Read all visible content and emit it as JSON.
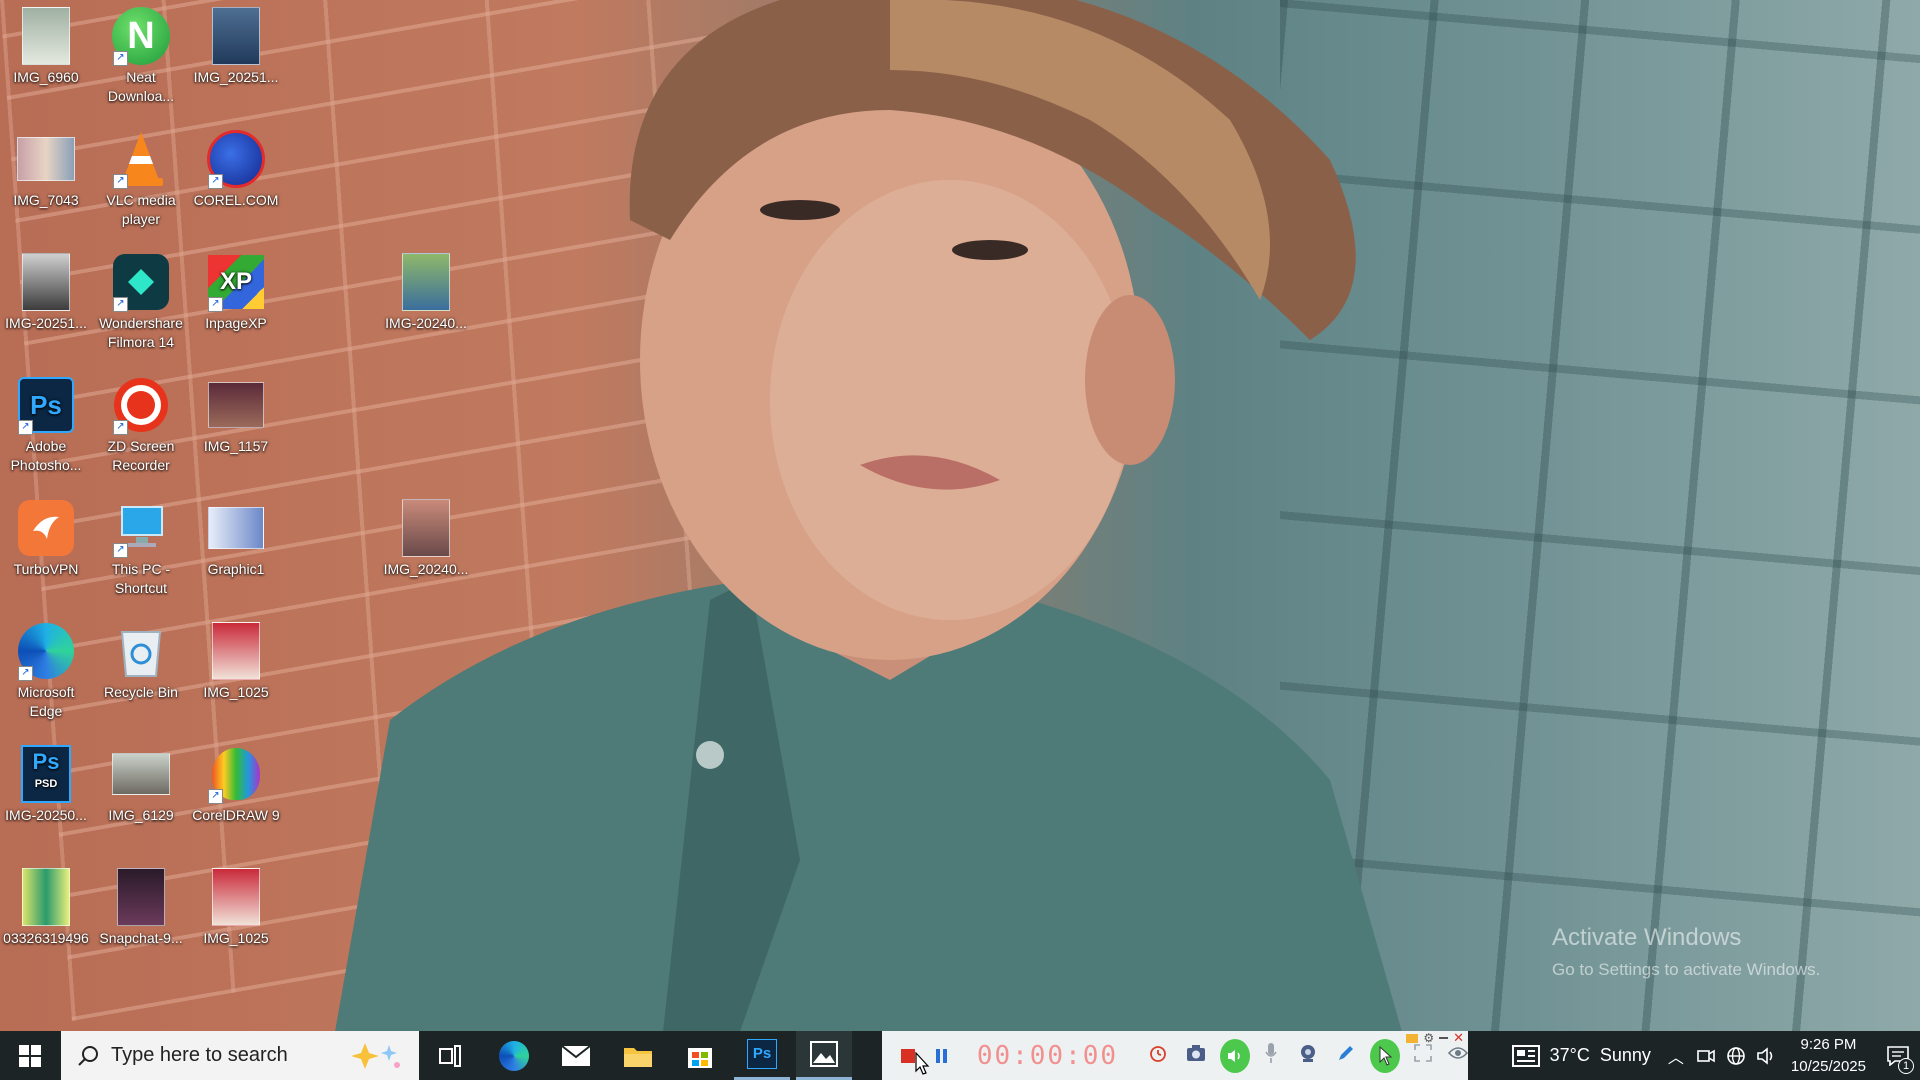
{
  "desktop": {
    "icons": [
      {
        "label": "IMG_6960"
      },
      {
        "label": "Neat Downloa..."
      },
      {
        "label": "IMG_20251..."
      },
      {
        "label": "IMG_7043"
      },
      {
        "label": "VLC media player"
      },
      {
        "label": "COREL.COM"
      },
      {
        "label": "IMG-20251..."
      },
      {
        "label": "Wondershare Filmora 14"
      },
      {
        "label": "InpageXP"
      },
      {
        "label": "IMG-20240..."
      },
      {
        "label": "Adobe Photosho..."
      },
      {
        "label": "ZD Screen Recorder"
      },
      {
        "label": "IMG_1157"
      },
      {
        "label": "TurboVPN"
      },
      {
        "label": "This PC - Shortcut"
      },
      {
        "label": "Graphic1"
      },
      {
        "label": "IMG_20240..."
      },
      {
        "label": "Microsoft Edge"
      },
      {
        "label": "Recycle Bin"
      },
      {
        "label": "IMG_1025"
      },
      {
        "label": "IMG-20250..."
      },
      {
        "label": "IMG_6129"
      },
      {
        "label": "CorelDRAW 9"
      },
      {
        "label": "03326319496"
      },
      {
        "label": "Snapchat-9..."
      },
      {
        "label": "IMG_1025"
      }
    ],
    "watermark": {
      "title": "Activate Windows",
      "subtitle": "Go to Settings to activate Windows."
    },
    "photo_text": {
      "ps_glyph": "Ps",
      "psd_glyph": "Ps",
      "psd_sub": "PSD",
      "neat_glyph": "N",
      "inpage_glyph": "XP"
    }
  },
  "taskbar": {
    "search_placeholder": "Type here to search",
    "pinned": [
      "task-view",
      "edge",
      "mail",
      "file-explorer",
      "store",
      "photoshop",
      "photos"
    ],
    "photoshop_glyph": "Ps"
  },
  "recorder": {
    "timer": "00:00:00"
  },
  "tray": {
    "weather": "37°C  Sunny",
    "time": "9:26 PM",
    "date": "10/25/2025",
    "notification_count": "1"
  },
  "colors": {
    "taskbar_bg": "#1c2426",
    "recorder_bg": "#eef1f2",
    "timer_color": "#f28f8f",
    "accent_green": "#4cc94c"
  }
}
